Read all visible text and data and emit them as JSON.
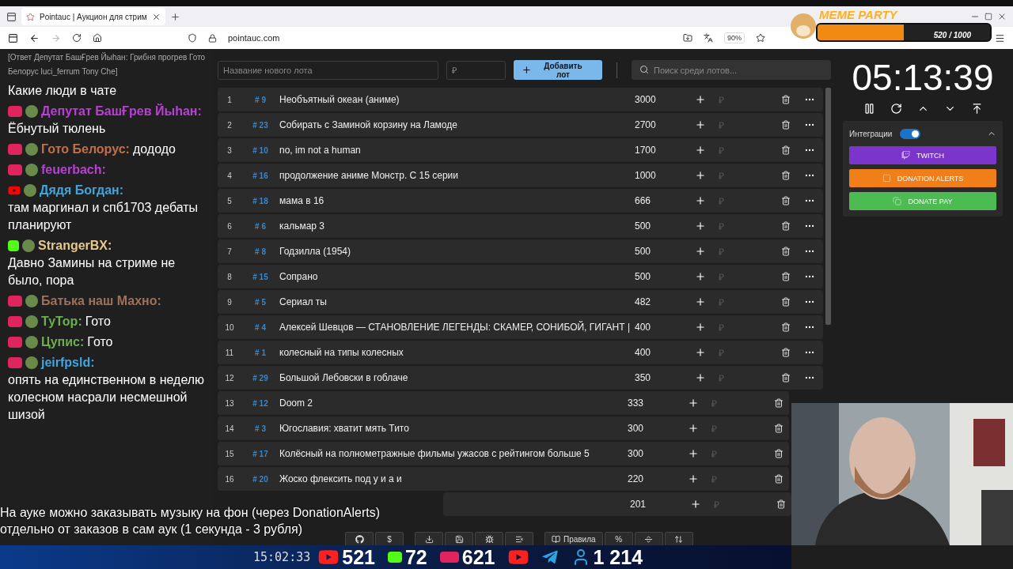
{
  "browser": {
    "tab_title": "Pointauc | Аукцион для стрим",
    "url": "pointauc.com",
    "zoom": "90%"
  },
  "meme_party": {
    "title": "MEME PARTY",
    "progress": "520 / 1000",
    "level": 0.5
  },
  "chat": {
    "reply": "[Ответ Депутат БашҒрев Йыһан: Грибня прогрев Гото Белорус luci_ferrum Tony Che]",
    "messages": [
      {
        "text": "Какие люди в чате"
      },
      {
        "kind": "live",
        "user": "Депутат БашҒрев Йыһан:",
        "color": "#b93fd6",
        "text": "Ёбнутый тюлень"
      },
      {
        "kind": "live",
        "user": "Гото Белорус:",
        "color": "#c0704a",
        "text": "дододо"
      },
      {
        "kind": "live",
        "user": "feuerbach:",
        "color": "#b93fd6"
      },
      {
        "kind": "youtube",
        "user": "Дядя Богдан:",
        "color": "#3ea6e0",
        "text": "там маргинал и спб1703 дебаты планируют"
      },
      {
        "kind": "kick",
        "user": "StrangerBX:",
        "color": "#e6c98a",
        "text": "Давно Замины на стриме не было, пора"
      },
      {
        "kind": "live",
        "user": "Батька наш Махно:",
        "color": "#a0705a"
      },
      {
        "kind": "live",
        "user": "ТуТор:",
        "color": "#6ab04c",
        "text": "Гото"
      },
      {
        "kind": "live",
        "user": "Цупис:",
        "color": "#6ab04c",
        "text": "Гото"
      },
      {
        "kind": "live",
        "user": "jeirfpsld:",
        "color": "#3ea6e0",
        "text": "опять на единственном в неделю колесном насрали несмешной шизой"
      }
    ]
  },
  "new_lot": {
    "name_placeholder": "Название нового лота",
    "amount_placeholder": "₽",
    "add_button": "Добавить лот",
    "search_placeholder": "Поиск среди лотов..."
  },
  "lots": [
    {
      "index": "1",
      "id": "# 9",
      "name": "Необъятный океан (аниме)",
      "amount": "3000",
      "currency": "₽",
      "menu": true
    },
    {
      "index": "2",
      "id": "# 23",
      "name": "Собирать с Заминой корзину на Ламоде",
      "amount": "2700",
      "currency": "₽",
      "menu": true
    },
    {
      "index": "3",
      "id": "# 10",
      "name": "no, im not a human",
      "amount": "1700",
      "currency": "₽",
      "menu": true
    },
    {
      "index": "4",
      "id": "# 16",
      "name": "продолжение аниме Монстр. С 15 серии",
      "amount": "1000",
      "currency": "₽",
      "menu": true
    },
    {
      "index": "5",
      "id": "# 18",
      "name": "мама в 16",
      "amount": "666",
      "currency": "₽",
      "menu": true
    },
    {
      "index": "6",
      "id": "# 6",
      "name": "кальмар 3",
      "amount": "500",
      "currency": "₽",
      "menu": true
    },
    {
      "index": "7",
      "id": "# 8",
      "name": "Годзилла (1954)",
      "amount": "500",
      "currency": "₽",
      "menu": true
    },
    {
      "index": "8",
      "id": "# 15",
      "name": "Сопрано",
      "amount": "500",
      "currency": "₽",
      "menu": true
    },
    {
      "index": "9",
      "id": "# 5",
      "name": "Сериал ты",
      "amount": "482",
      "currency": "₽",
      "menu": true
    },
    {
      "index": "10",
      "id": "# 4",
      "name": "Алексей Шевцов — СТАНОВЛЕНИЕ ЛЕГЕНДЫ: СКАМЕР, СОНИБОЙ, ГИГАНТ |",
      "amount": "400",
      "currency": "₽",
      "menu": true
    },
    {
      "index": "11",
      "id": "# 1",
      "name": "колесный на типы колесных",
      "amount": "400",
      "currency": "₽",
      "menu": true
    },
    {
      "index": "12",
      "id": "# 29",
      "name": "Большой Лебовски в гоблаче",
      "amount": "350",
      "currency": "₽",
      "menu": true
    },
    {
      "index": "13",
      "id": "# 12",
      "name": "Doom 2",
      "amount": "333",
      "currency": "₽",
      "menu": false
    },
    {
      "index": "14",
      "id": "# 3",
      "name": "Югославия: хватит мять Тито",
      "amount": "300",
      "currency": "₽",
      "menu": false
    },
    {
      "index": "15",
      "id": "# 17",
      "name": "Колёсный на полнометражные фильмы ужасов с рейтингом больше 5",
      "amount": "300",
      "currency": "₽",
      "menu": false
    },
    {
      "index": "16",
      "id": "# 20",
      "name": "Жоско флексить под у и а и",
      "amount": "220",
      "currency": "₽",
      "menu": false
    },
    {
      "amount": "201",
      "currency": "₽",
      "menu": false
    }
  ],
  "timer": {
    "time": "05:13:39"
  },
  "integrations": {
    "label": "Интеграции",
    "on": true,
    "buttons": [
      {
        "kind": "twitch",
        "label": "TWITCH"
      },
      {
        "kind": "donationalerts",
        "label": "DONATION ALERTS"
      },
      {
        "kind": "donatepay",
        "label": "DONATE PAY"
      }
    ]
  },
  "caption": [
    "На ауке можно заказывать музыку на фон (через DonationAlerts)",
    "отдельно от заказов в сам аук (1 секунда - 3 рубля)"
  ],
  "toolbar": [
    {
      "kind": "github"
    },
    {
      "kind": "text",
      "label": "$"
    },
    {
      "kind": "download"
    },
    {
      "kind": "save"
    },
    {
      "kind": "bug"
    },
    {
      "kind": "clear"
    },
    {
      "kind": "rules",
      "label": "Правила"
    },
    {
      "kind": "text",
      "label": "%"
    },
    {
      "kind": "split"
    },
    {
      "kind": "sort"
    }
  ],
  "stream_bar": {
    "time": "15:02:33",
    "stats": [
      {
        "kind": "youtube",
        "count": "521"
      },
      {
        "kind": "kick",
        "count": "72"
      },
      {
        "kind": "live",
        "count": "621"
      },
      {
        "kind": "youtube"
      },
      {
        "kind": "telegram"
      },
      {
        "kind": "viewers",
        "count": "1 214"
      }
    ]
  }
}
